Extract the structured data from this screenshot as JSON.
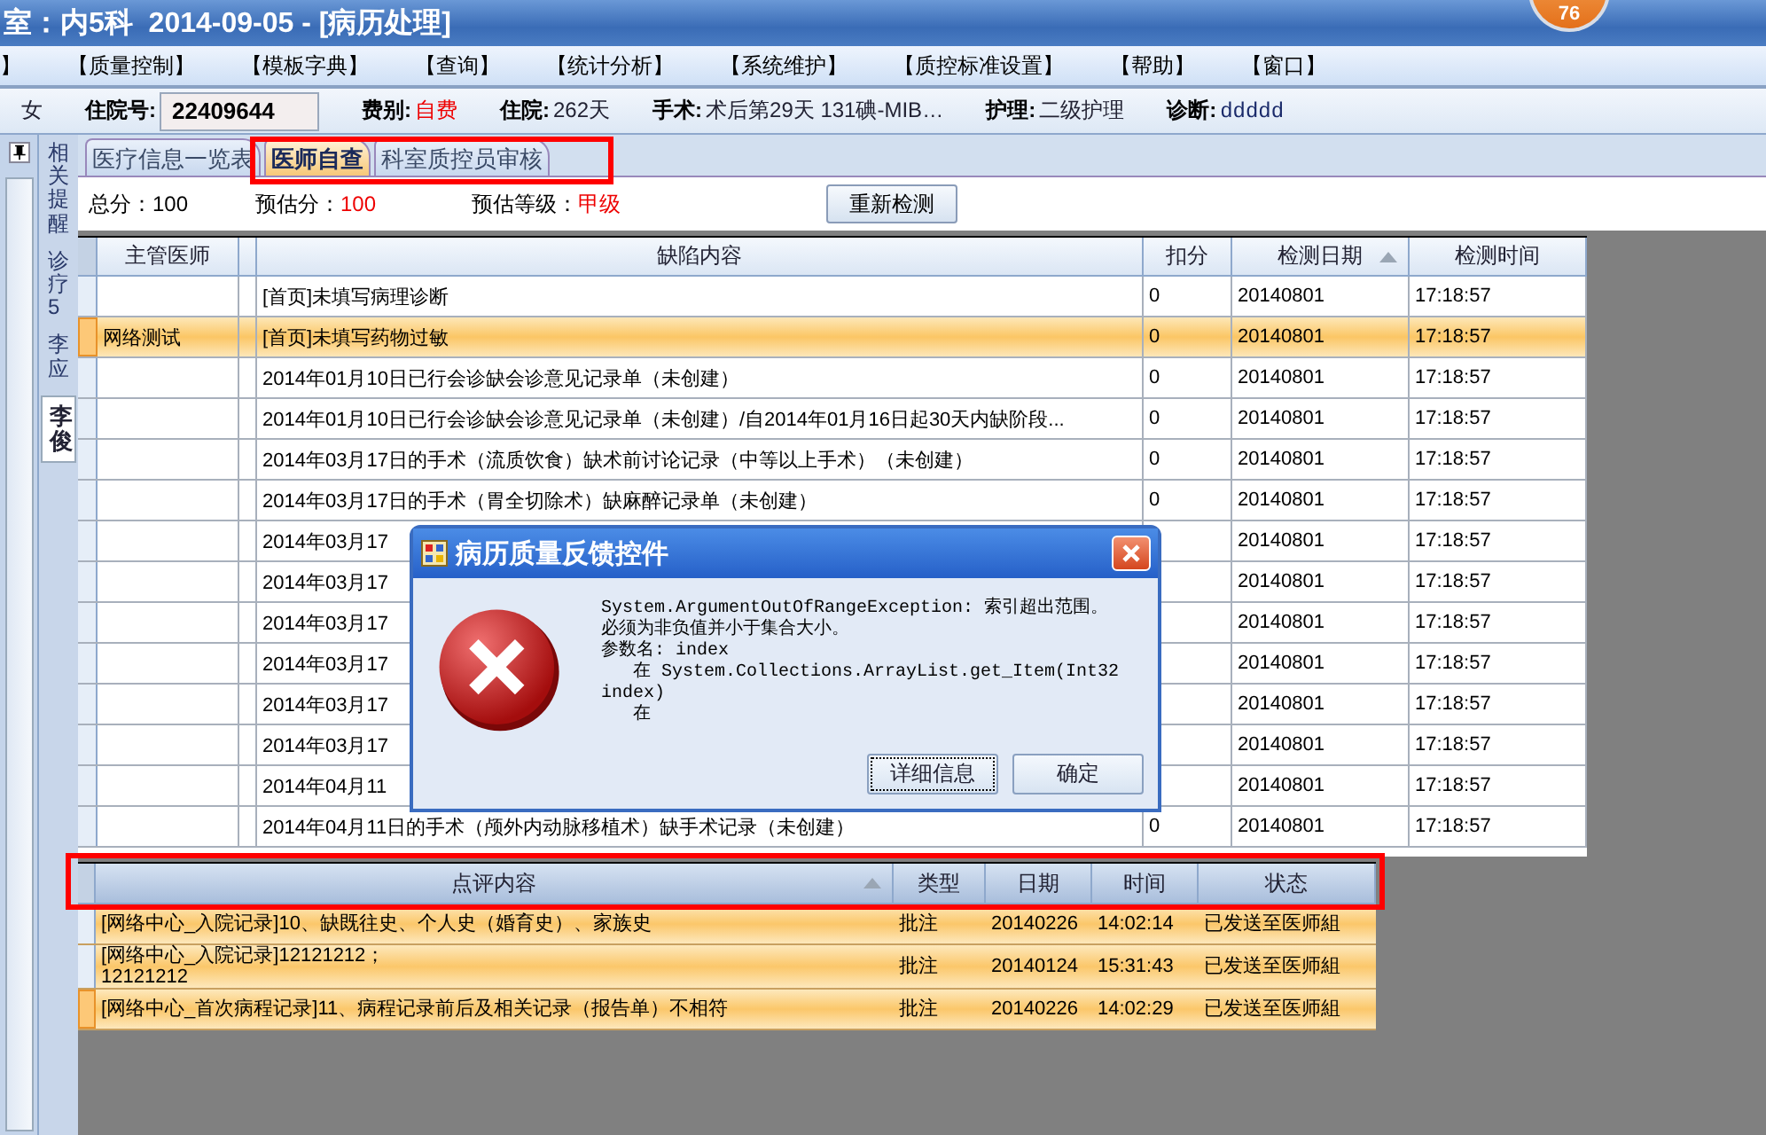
{
  "window": {
    "title": "室：内5科  2014-09-05 - [病历处理]",
    "badge": "76"
  },
  "menu": [
    "】",
    "【质量控制】",
    "【模板字典】",
    "【查询】",
    "【统计分析】",
    "【系统维护】",
    "【质控标准设置】",
    "【帮助】",
    "【窗口】"
  ],
  "patient": [
    {
      "kind": "plain",
      "value": "女"
    },
    {
      "kind": "field",
      "label": "住院号:",
      "value": "22409644"
    },
    {
      "kind": "alert",
      "label": "费别:",
      "value": "自费"
    },
    {
      "kind": "plain",
      "label": "住院:",
      "value": "262天"
    },
    {
      "kind": "plain",
      "label": "手术:",
      "value": "术后第29天 131碘-MIB…"
    },
    {
      "kind": "plain",
      "label": "护理:",
      "value": "二级护理"
    },
    {
      "kind": "mono",
      "label": "诊断:",
      "value": "ddddd"
    }
  ],
  "side_tabs": [
    {
      "label": "相关提醒",
      "selected": false
    },
    {
      "label": "诊疗5",
      "selected": false
    },
    {
      "label": "李应",
      "selected": false
    },
    {
      "label": "李俊",
      "selected": true
    }
  ],
  "tabs": {
    "highlighted": true,
    "items": [
      {
        "label": "医疗信息一览表",
        "selected": false
      },
      {
        "label": "医师自查",
        "selected": true
      },
      {
        "label": "科室质控员审核",
        "selected": false
      }
    ]
  },
  "summary": {
    "total": "总分：100",
    "estimate_label": "预估分：",
    "estimate": "100",
    "grade_label": "预估等级：",
    "grade": "甲级",
    "button": "重新检测"
  },
  "defects": {
    "columns": [
      {
        "label": "主管医师",
        "sorted": false
      },
      {
        "label": "缺陷内容",
        "sorted": false
      },
      {
        "label": "扣分",
        "sorted": false
      },
      {
        "label": "检测日期",
        "sorted": true
      },
      {
        "label": "检测时间",
        "sorted": false
      }
    ],
    "rows": [
      {
        "doctor": "",
        "content": "[首页]未填写病理诊断",
        "score": "0",
        "date": "20140801",
        "time": "17:18:57",
        "selected": false
      },
      {
        "doctor": "网络测试",
        "content": "[首页]未填写药物过敏",
        "score": "0",
        "date": "20140801",
        "time": "17:18:57",
        "selected": true
      },
      {
        "doctor": "",
        "content": "2014年01月10日已行会诊缺会诊意见记录单（未创建）",
        "score": "0",
        "date": "20140801",
        "time": "17:18:57",
        "selected": false
      },
      {
        "doctor": "",
        "content": "2014年01月10日已行会诊缺会诊意见记录单（未创建）/自2014年01月16日起30天内缺阶段...",
        "score": "0",
        "date": "20140801",
        "time": "17:18:57",
        "selected": false
      },
      {
        "doctor": "",
        "content": "2014年03月17日的手术（流质饮食）缺术前讨论记录（中等以上手术）（未创建）",
        "score": "0",
        "date": "20140801",
        "time": "17:18:57",
        "selected": false
      },
      {
        "doctor": "",
        "content": "2014年03月17日的手术（胃全切除术）缺麻醉记录单（未创建）",
        "score": "0",
        "date": "20140801",
        "time": "17:18:57",
        "selected": false
      },
      {
        "doctor": "",
        "content": "2014年03月17",
        "score": "",
        "date": "20140801",
        "time": "17:18:57",
        "selected": false
      },
      {
        "doctor": "",
        "content": "2014年03月17",
        "score": "",
        "date": "20140801",
        "time": "17:18:57",
        "selected": false
      },
      {
        "doctor": "",
        "content": "2014年03月17",
        "score": "",
        "date": "20140801",
        "time": "17:18:57",
        "selected": false
      },
      {
        "doctor": "",
        "content": "2014年03月17",
        "score": "",
        "date": "20140801",
        "time": "17:18:57",
        "selected": false
      },
      {
        "doctor": "",
        "content": "2014年03月17",
        "score": "",
        "date": "20140801",
        "time": "17:18:57",
        "selected": false
      },
      {
        "doctor": "",
        "content": "2014年03月17",
        "score": "",
        "date": "20140801",
        "time": "17:18:57",
        "selected": false
      },
      {
        "doctor": "",
        "content": "2014年04月11",
        "score": "",
        "date": "20140801",
        "time": "17:18:57",
        "selected": false
      },
      {
        "doctor": "",
        "content": "2014年04月11日的手术（颅外内动脉移植术）缺手术记录（未创建）",
        "score": "0",
        "date": "20140801",
        "time": "17:18:57",
        "selected": false
      }
    ]
  },
  "comments": {
    "highlighted": true,
    "columns": [
      {
        "label": "点评内容",
        "sorted": true
      },
      {
        "label": "类型",
        "sorted": false
      },
      {
        "label": "日期",
        "sorted": false
      },
      {
        "label": "时间",
        "sorted": false
      },
      {
        "label": "状态",
        "sorted": false
      }
    ],
    "rows": [
      {
        "content": "[网络中心_入院记录]10、缺既往史、个人史（婚育史）、家族史",
        "type": "批注",
        "date": "20140226",
        "time": "14:02:14",
        "status": "已发送至医师組",
        "selected": false
      },
      {
        "content": "[网络中心_入院记录]12121212；\n12121212",
        "type": "批注",
        "date": "20140124",
        "time": "15:31:43",
        "status": "已发送至医师組",
        "selected": false
      },
      {
        "content": "[网络中心_首次病程记录]11、病程记录前后及相关记录（报告单）不相符",
        "type": "批注",
        "date": "20140226",
        "time": "14:02:29",
        "status": "已发送至医师組",
        "selected": true
      }
    ]
  },
  "dialog": {
    "title": "病历质量反馈控件",
    "message_lines": [
      "System.ArgumentOutOfRangeException: 索引超出范围。",
      "必须为非负值并小于集合大小。",
      "参数名: index",
      "   在 System.Collections.ArrayList.get_Item(Int32",
      "index)",
      "   在"
    ],
    "buttons": [
      {
        "label": "详细信息",
        "focused": true
      },
      {
        "label": "确定",
        "focused": false
      }
    ]
  }
}
